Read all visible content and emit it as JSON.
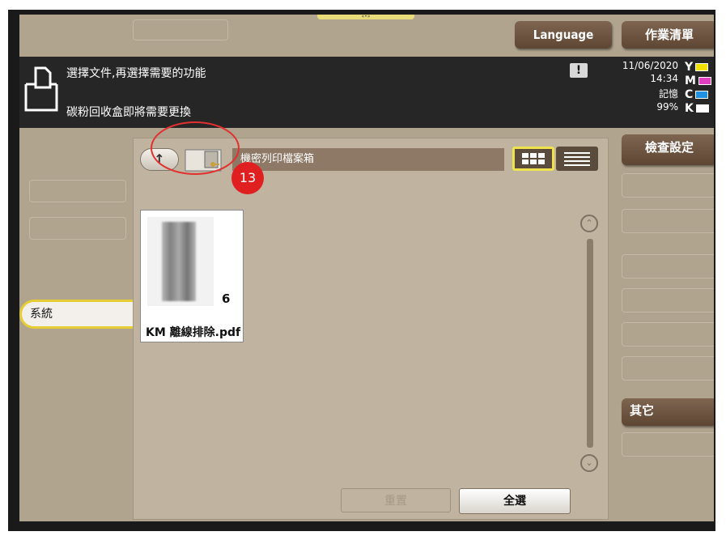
{
  "header": {
    "language_button": "Language",
    "jobs_button": "作業清單"
  },
  "status": {
    "message_line1": "選擇文件,再選擇需要的功能",
    "message_line2": "碳粉回收盒即將需要更換",
    "alert_icon": "!",
    "date": "11/06/2020",
    "time": "14:34",
    "memory_label": "記憶",
    "memory_percent": "99%",
    "toner": [
      {
        "letter": "Y",
        "color": "#f2e000"
      },
      {
        "letter": "M",
        "color": "#e040c0"
      },
      {
        "letter": "C",
        "color": "#2090e0"
      },
      {
        "letter": "K",
        "color": "#ffffff"
      }
    ]
  },
  "panel": {
    "up_icon": "↑",
    "path": "機密列印檔案箱",
    "annotation_number": "13",
    "file": {
      "name": "KM 離線排除.pdf",
      "pages": "6"
    },
    "scroll_up_icon": "⌃",
    "scroll_down_icon": "⌄",
    "reset_button": "重置",
    "select_all_button": "全選"
  },
  "left_nav": {
    "system_tab": "系統"
  },
  "right_nav": {
    "check_settings": "檢查設定",
    "other": "其它"
  }
}
